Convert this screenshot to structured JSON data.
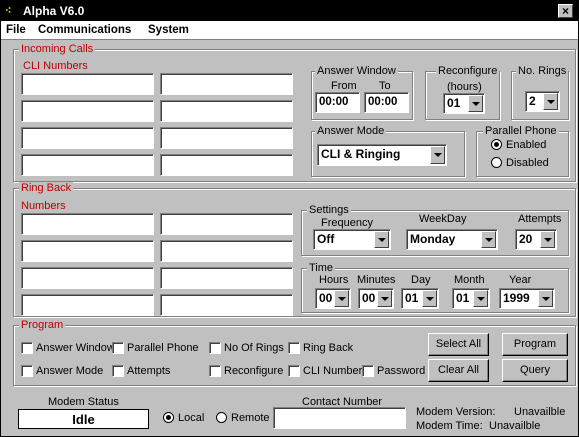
{
  "window": {
    "title": "Alpha V6.0",
    "icon": "app-icon",
    "close_glyph": "×"
  },
  "menu": {
    "items": [
      "File",
      "Communications",
      "System"
    ]
  },
  "incoming": {
    "legend": "Incoming Calls",
    "cli_label": "CLI Numbers",
    "cli_fields": [
      "",
      "",
      "",
      "",
      "",
      "",
      "",
      ""
    ],
    "answer_window": {
      "legend": "Answer Window",
      "from_label": "From",
      "to_label": "To",
      "from": "00:00",
      "to": "00:00"
    },
    "reconfigure": {
      "legend": "Reconfigure",
      "sub": "(hours)",
      "value": "01"
    },
    "rings": {
      "legend": "No. Rings",
      "value": "2"
    },
    "answer_mode": {
      "legend": "Answer Mode",
      "value": "CLI & Ringing"
    },
    "parallel_phone": {
      "legend": "Parallel Phone",
      "enabled_label": "Enabled",
      "disabled_label": "Disabled",
      "selected": "Enabled"
    }
  },
  "ringback": {
    "legend": "Ring Back",
    "numbers_label": "Numbers",
    "number_fields": [
      "",
      "",
      "",
      "",
      "",
      "",
      "",
      ""
    ],
    "settings": {
      "legend": "Settings",
      "frequency_label": "Frequency",
      "weekday_label": "WeekDay",
      "attempts_label": "Attempts",
      "frequency": "Off",
      "weekday": "Monday",
      "attempts": "20"
    },
    "time": {
      "legend": "Time",
      "hours_label": "Hours",
      "minutes_label": "Minutes",
      "day_label": "Day",
      "month_label": "Month",
      "year_label": "Year",
      "hours": "00",
      "minutes": "00",
      "day": "01",
      "month": "01",
      "year": "1999"
    }
  },
  "program": {
    "legend": "Program",
    "checks": [
      {
        "label": "Answer Window",
        "checked": false
      },
      {
        "label": "Parallel Phone",
        "checked": false
      },
      {
        "label": "No Of Rings",
        "checked": false
      },
      {
        "label": "Ring Back",
        "checked": false
      },
      {
        "label": "Answer Mode",
        "checked": false
      },
      {
        "label": "Attempts",
        "checked": false
      },
      {
        "label": "Reconfigure",
        "checked": false
      },
      {
        "label": "CLI Numbers",
        "checked": false
      },
      {
        "label": "Password",
        "checked": false
      }
    ],
    "select_all": "Select All",
    "clear_all": "Clear All",
    "program_btn": "Program",
    "query_btn": "Query"
  },
  "status": {
    "modem_status_label": "Modem Status",
    "modem_status": "Idle",
    "local_label": "Local",
    "remote_label": "Remote",
    "connection": "Local",
    "contact_label": "Contact Number",
    "contact_value": "",
    "version_label": "Modem Version:",
    "version_value": "Unavailble",
    "time_label": "Modem Time:",
    "time_value": "Unavailble"
  },
  "colors": {
    "title_bg": "#000000",
    "window_bg": "#c0c0c0",
    "legend_red": "#c00000",
    "field_bg": "#ffffff"
  }
}
